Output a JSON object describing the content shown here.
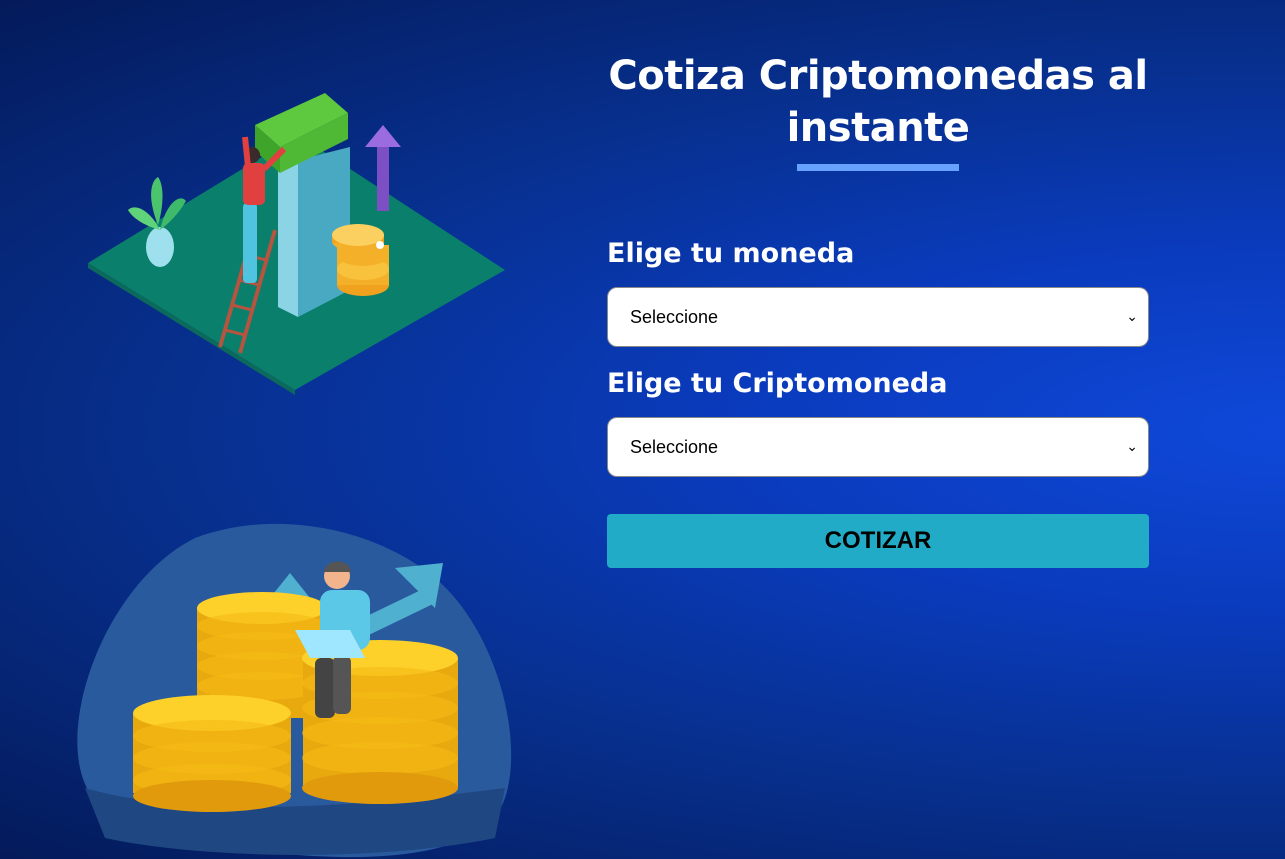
{
  "header": {
    "title": "Cotiza Criptomonedas al instante"
  },
  "form": {
    "currency_label": "Elige tu moneda",
    "currency_selected": "Seleccione",
    "crypto_label": "Elige tu Criptomoneda",
    "crypto_selected": "Seleccione",
    "submit_label": "COTIZAR"
  },
  "icons": {
    "select_arrow": "chevron-down-icon"
  },
  "colors": {
    "accent_underline": "#66a2fe",
    "button": "#22abc7",
    "background_dark": "#041a5a",
    "background_light": "#0f48d9"
  }
}
